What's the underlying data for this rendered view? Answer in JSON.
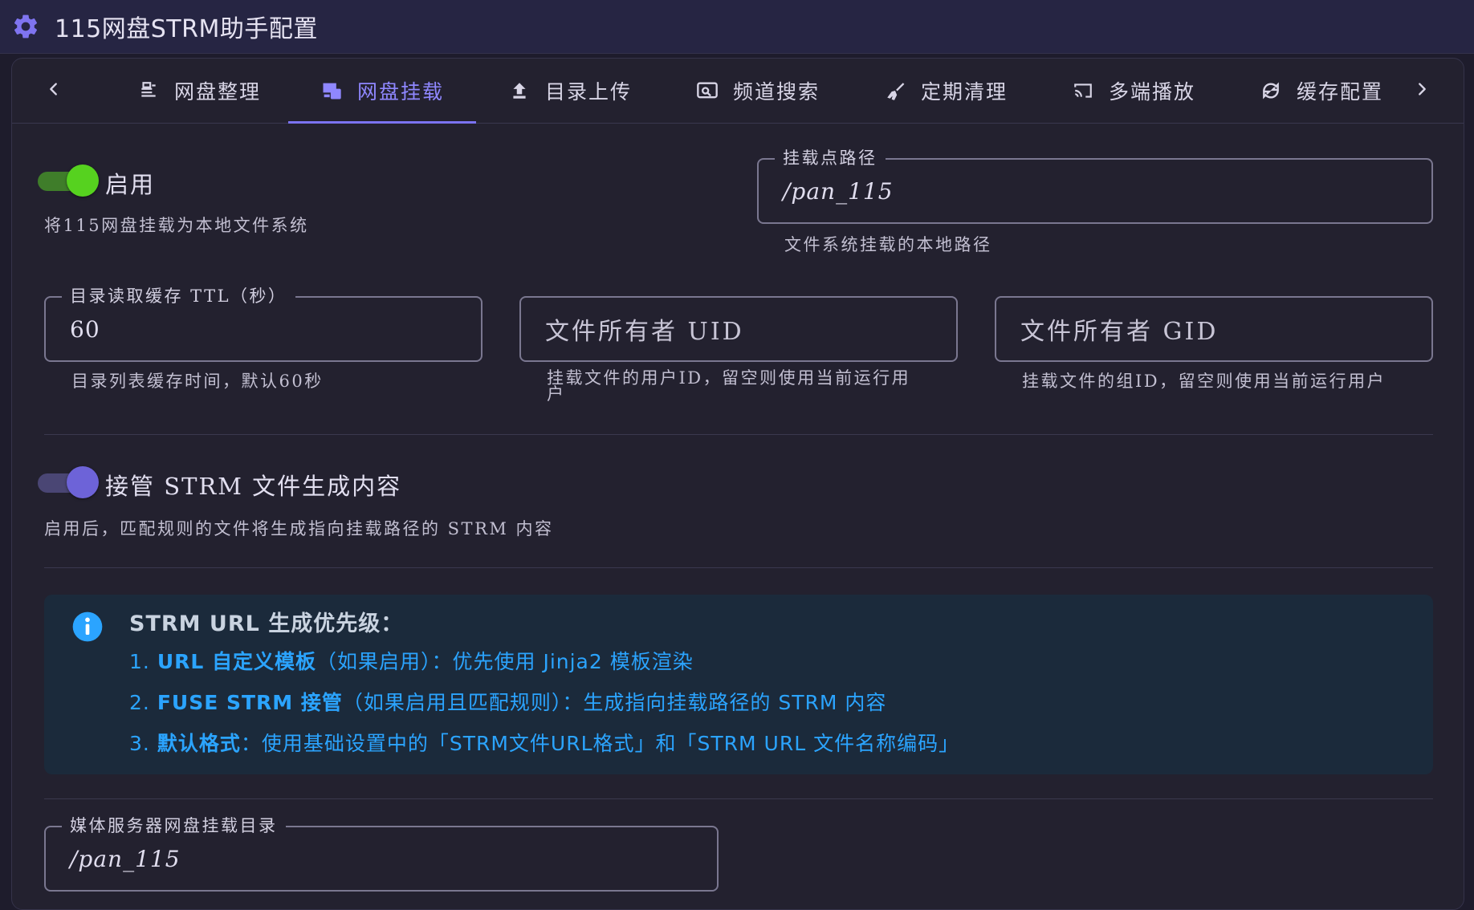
{
  "window": {
    "title": "115网盘STRM助手配置"
  },
  "tabs": [
    {
      "label": "网盘整理",
      "icon": "sort-icon"
    },
    {
      "label": "网盘挂载",
      "icon": "drive-mount-icon",
      "active": true
    },
    {
      "label": "目录上传",
      "icon": "upload-icon"
    },
    {
      "label": "频道搜索",
      "icon": "channel-search-icon"
    },
    {
      "label": "定期清理",
      "icon": "broom-icon"
    },
    {
      "label": "多端播放",
      "icon": "cast-icon"
    },
    {
      "label": "缓存配置",
      "icon": "refresh-icon"
    }
  ],
  "mount": {
    "enable_label": "启用",
    "enable_on": true,
    "enable_hint": "将115网盘挂载为本地文件系统",
    "mount_path_label": "挂载点路径",
    "mount_path_value": "/pan_115",
    "mount_path_hint": "文件系统挂载的本地路径",
    "ttl_label": "目录读取缓存 TTL（秒）",
    "ttl_value": "60",
    "ttl_hint": "目录列表缓存时间，默认60秒",
    "uid_placeholder": "文件所有者 UID",
    "uid_hint_1": "挂载文件的用户ID，留空则使用当前运行用",
    "uid_hint_2": "户",
    "gid_placeholder": "文件所有者 GID",
    "gid_hint": "挂载文件的组ID，留空则使用当前运行用户",
    "strm_toggle_label": "接管 STRM 文件生成内容",
    "strm_toggle_on": true,
    "strm_toggle_hint": "启用后，匹配规则的文件将生成指向挂载路径的 STRM 内容",
    "media_dir_label": "媒体服务器网盘挂载目录",
    "media_dir_value": "/pan_115"
  },
  "info": {
    "heading": "STRM URL 生成优先级：",
    "lines": [
      {
        "num": "1. ",
        "bold": "URL 自定义模板",
        "rest": "（如果启用）：优先使用 Jinja2 模板渲染"
      },
      {
        "num": "2. ",
        "bold": "FUSE STRM 接管",
        "rest": "（如果启用且匹配规则）：生成指向挂载路径的 STRM 内容"
      },
      {
        "num": "3. ",
        "bold": "默认格式",
        "rest": "：使用基础设置中的「STRM文件URL格式」和「STRM URL 文件名称编码」"
      }
    ]
  },
  "colors": {
    "accent": "#7b73f2",
    "toggle_green": "#56d21f",
    "info_blue": "#2ba4ff",
    "background": "#1e1c2c"
  }
}
